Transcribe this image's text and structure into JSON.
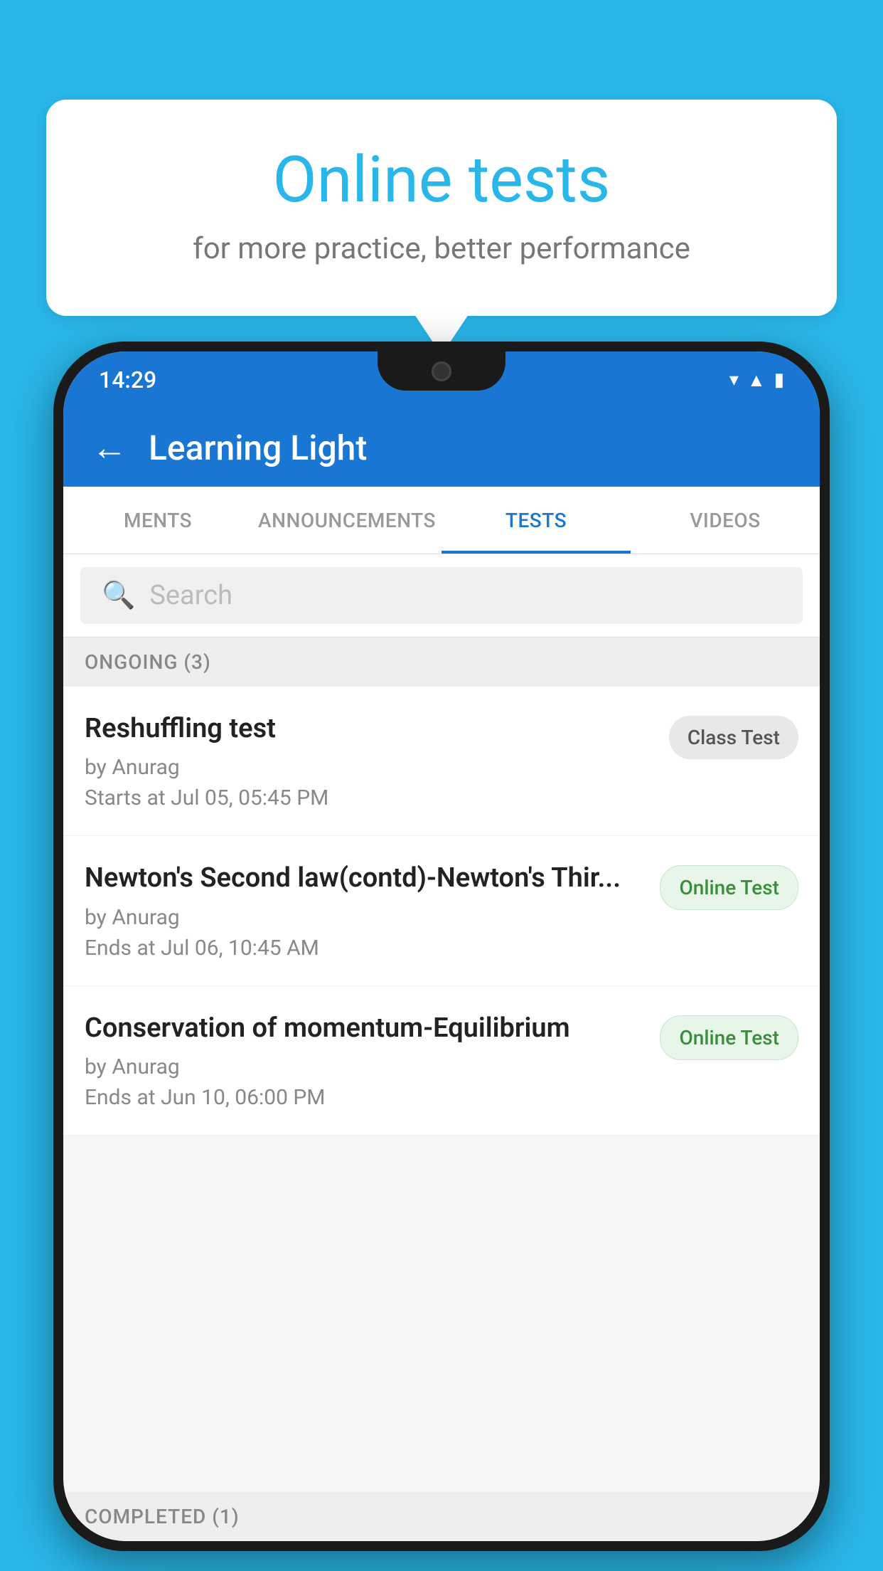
{
  "background": {
    "color": "#29b6e8"
  },
  "speech_bubble": {
    "title": "Online tests",
    "subtitle": "for more practice, better performance"
  },
  "phone": {
    "status_bar": {
      "time": "14:29",
      "icons": [
        "wifi",
        "signal",
        "battery"
      ]
    },
    "app_bar": {
      "title": "Learning Light",
      "back_label": "←"
    },
    "tabs": [
      {
        "label": "MENTS",
        "active": false
      },
      {
        "label": "ANNOUNCEMENTS",
        "active": false
      },
      {
        "label": "TESTS",
        "active": true
      },
      {
        "label": "VIDEOS",
        "active": false
      }
    ],
    "search": {
      "placeholder": "Search"
    },
    "sections": [
      {
        "label": "ONGOING (3)",
        "tests": [
          {
            "name": "Reshuffling test",
            "author": "by Anurag",
            "time_label": "Starts at",
            "time": "Jul 05, 05:45 PM",
            "badge": "Class Test",
            "badge_type": "class"
          },
          {
            "name": "Newton's Second law(contd)-Newton's Thir...",
            "author": "by Anurag",
            "time_label": "Ends at",
            "time": "Jul 06, 10:45 AM",
            "badge": "Online Test",
            "badge_type": "online"
          },
          {
            "name": "Conservation of momentum-Equilibrium",
            "author": "by Anurag",
            "time_label": "Ends at",
            "time": "Jun 10, 06:00 PM",
            "badge": "Online Test",
            "badge_type": "online"
          }
        ]
      }
    ],
    "completed_section": {
      "label": "COMPLETED (1)"
    }
  }
}
